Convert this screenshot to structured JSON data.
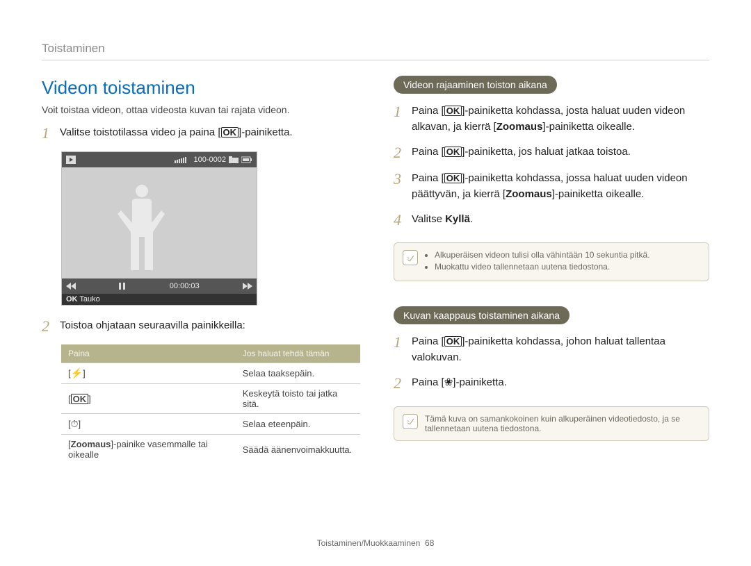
{
  "header": "Toistaminen",
  "left": {
    "title": "Videon toistaminen",
    "intro": "Voit toistaa videon, ottaa videosta kuvan tai rajata videon.",
    "step1_pre": "Valitse toistotilassa video ja paina [",
    "step1_post": "]-painiketta.",
    "screenshot": {
      "counter": "100-0002",
      "time": "00:00:03",
      "pause_label": "Tauko",
      "ok_prefix": "OK"
    },
    "step2": "Toistoa ohjataan seuraavilla painikkeilla:",
    "table": {
      "h1": "Paina",
      "h2": "Jos haluat tehdä tämän",
      "rows": [
        {
          "key_type": "flash",
          "desc": "Selaa taaksepäin."
        },
        {
          "key_type": "ok",
          "desc": "Keskeytä toisto tai jatka sitä."
        },
        {
          "key_type": "timer",
          "desc": "Selaa eteenpäin."
        },
        {
          "key_type": "zoom_text",
          "key_text": "Zoomaus",
          "key_suffix": "-painike vasemmalle tai oikealle",
          "desc": "Säädä äänenvoimakkuutta."
        }
      ]
    }
  },
  "right": {
    "sectionA": {
      "pill": "Videon rajaaminen toiston aikana",
      "s1a": "Paina [",
      "s1b": "]-painiketta kohdassa, josta haluat uuden videon alkavan, ja kierrä [",
      "s1c": "]-painiketta oikealle.",
      "s1_bold": "Zoomaus",
      "s2a": "Paina [",
      "s2b": "]-painiketta, jos haluat jatkaa toistoa.",
      "s3a": "Paina [",
      "s3b": "]-painiketta kohdassa, jossa haluat uuden videon päättyvän, ja kierrä [",
      "s3c": "]-painiketta oikealle.",
      "s3_bold": "Zoomaus",
      "s4a": "Valitse ",
      "s4_bold": "Kyllä",
      "s4b": ".",
      "note": {
        "li1": "Alkuperäisen videon tulisi olla vähintään 10 sekuntia pitkä.",
        "li2": "Muokattu video tallennetaan uutena tiedostona."
      }
    },
    "sectionB": {
      "pill": "Kuvan kaappaus toistaminen aikana",
      "s1a": "Paina [",
      "s1b": "]-painiketta kohdassa, johon haluat tallentaa valokuvan.",
      "s2a": "Paina [",
      "s2b": "]-painiketta.",
      "note": "Tämä kuva on samankokoinen kuin alkuperäinen videotiedosto, ja se tallennetaan uutena tiedostona."
    }
  },
  "footer": {
    "label": "Toistaminen/Muokkaaminen",
    "page": "68"
  }
}
